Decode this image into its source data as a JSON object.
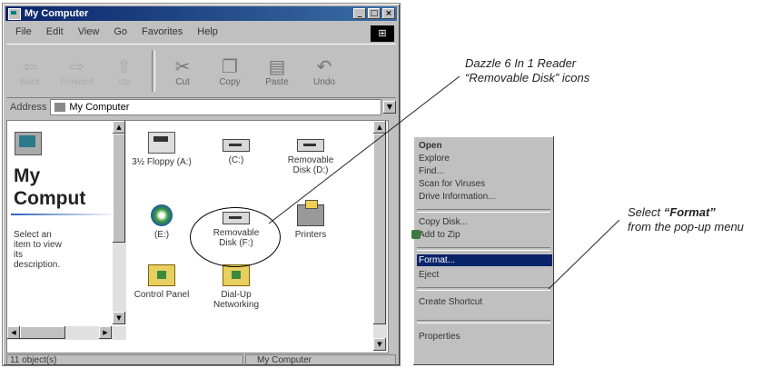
{
  "window": {
    "title": "My Computer",
    "buttons": [
      "_",
      "□",
      "×"
    ],
    "menu": [
      "File",
      "Edit",
      "View",
      "Go",
      "Favorites",
      "Help"
    ],
    "toolbar": [
      {
        "label": "Back",
        "glyph": "⇦"
      },
      {
        "label": "Forward",
        "glyph": "⇨"
      },
      {
        "label": "Up",
        "glyph": "⇧"
      },
      {
        "label": "Cut",
        "glyph": "✂"
      },
      {
        "label": "Copy",
        "glyph": "❐"
      },
      {
        "label": "Paste",
        "glyph": "▤"
      },
      {
        "label": "Undo",
        "glyph": "↶"
      }
    ],
    "address_label": "Address",
    "address_value": "My Computer",
    "left_pane": {
      "title_line1": "My",
      "title_line2": "Comput",
      "description": "Select an item to view its description."
    },
    "items": [
      {
        "label": "3½ Floppy (A:)",
        "icon": "floppy-icon"
      },
      {
        "label": "(C:)",
        "icon": "drive-icon"
      },
      {
        "label": "Removable Disk (D:)",
        "icon": "drive-icon"
      },
      {
        "label": "(E:)",
        "icon": "cd-drive-icon"
      },
      {
        "label": "Removable Disk (F:)",
        "icon": "drive-icon"
      },
      {
        "label": "Printers",
        "icon": "printer-icon"
      },
      {
        "label": "Control Panel",
        "icon": "control-panel-icon"
      },
      {
        "label": "Dial-Up Networking",
        "icon": "dialup-icon"
      }
    ],
    "status_left": "11 object(s)",
    "status_right": "My Computer"
  },
  "context_menu": {
    "items": [
      {
        "label": "Open",
        "bold": true
      },
      {
        "label": "Explore"
      },
      {
        "label": "Find..."
      },
      {
        "label": "Scan for Viruses"
      },
      {
        "label": "Drive Information..."
      },
      {
        "sep": true
      },
      {
        "label": "Copy Disk..."
      },
      {
        "label": "Add to Zip"
      },
      {
        "sep": true
      },
      {
        "label": "Format...",
        "selected": true
      },
      {
        "label": "Eject"
      },
      {
        "sep": true
      },
      {
        "label": "Create Shortcut"
      },
      {
        "sep": true
      },
      {
        "label": "Properties"
      }
    ]
  },
  "annotations": {
    "reader_line1": "Dazzle 6 In 1 Reader",
    "reader_line2": "“Removable Disk” icons",
    "format_prefix": "Select ",
    "format_bold": "“Format”",
    "format_line2": "from the pop-up menu"
  }
}
